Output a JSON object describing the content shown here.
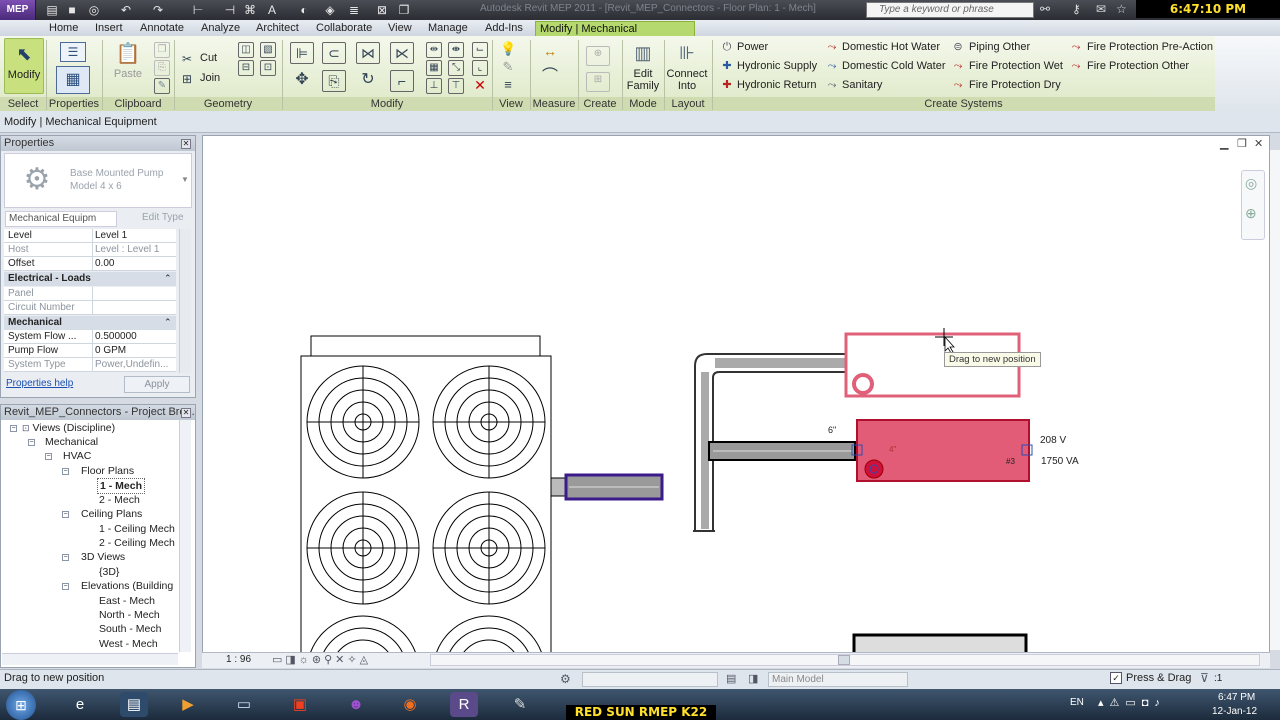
{
  "title_bar": {
    "app_label": "MEP",
    "title": "Autodesk Revit MEP 2011 - [Revit_MEP_Connectors - Floor Plan: 1 - Mech]",
    "search_placeholder": "Type a keyword or phrase",
    "clock_overlay": "6:47:10 PM 01/12/2012"
  },
  "tabs": [
    "Home",
    "Insert",
    "Annotate",
    "Analyze",
    "Architect",
    "Collaborate",
    "View",
    "Manage",
    "Add-Ins",
    "Modify | Mechanical Equipment"
  ],
  "ribbon": {
    "modify_label": "Modify",
    "paste_label": "Paste",
    "cut_label": "Cut",
    "join_label": "Join",
    "edit_family_label": "Edit Family",
    "connect_into_label": "Connect Into",
    "panels": [
      "Select",
      "Properties",
      "Clipboard",
      "Geometry",
      "Modify",
      "View",
      "Measure",
      "Create",
      "Mode",
      "Layout",
      "Create Systems"
    ],
    "systems": [
      [
        "Power",
        "Domestic Hot Water",
        "Piping Other",
        "Fire Protection Pre-Action"
      ],
      [
        "Hydronic Supply",
        "Domestic Cold Water",
        "Fire Protection Wet",
        "Fire Protection Other"
      ],
      [
        "Hydronic Return",
        "Sanitary",
        "Fire Protection Dry"
      ]
    ]
  },
  "options_bar": "Modify | Mechanical Equipment",
  "properties": {
    "title": "Properties",
    "type_name": "Base Mounted Pump",
    "type_model": "Model 4 x 6",
    "category": "Mechanical Equipm",
    "edit_type": "Edit Type",
    "rows": [
      {
        "k": "Level",
        "v": "Level 1"
      },
      {
        "k": "Host",
        "v": "Level : Level 1"
      },
      {
        "k": "Offset",
        "v": "0.00"
      }
    ],
    "group_electrical": "Electrical - Loads",
    "electrical_rows": [
      {
        "k": "Panel",
        "v": ""
      },
      {
        "k": "Circuit Number",
        "v": ""
      }
    ],
    "group_mechanical": "Mechanical",
    "mechanical_rows": [
      {
        "k": "System Flow ...",
        "v": "0.500000"
      },
      {
        "k": "Pump Flow",
        "v": "0 GPM"
      },
      {
        "k": "System Type",
        "v": "Power,Undefin..."
      }
    ],
    "help": "Properties help",
    "apply": "Apply"
  },
  "browser": {
    "title": "Revit_MEP_Connectors - Project Bro...",
    "nodes": [
      "Views (Discipline)",
      "Mechanical",
      "HVAC",
      "Floor Plans",
      "1 - Mech",
      "2 - Mech",
      "Ceiling Plans",
      "1 - Ceiling Mech",
      "2 - Ceiling Mech",
      "3D Views",
      "{3D}",
      "Elevations (Building",
      "East - Mech",
      "North - Mech",
      "South - Mech",
      "West - Mech"
    ]
  },
  "canvas": {
    "tooltip": "Drag to new position",
    "pipe_size": "6\"",
    "pipe_size_small": "4\"",
    "conn_label": "#3",
    "voltage": "208 V",
    "load": "1750 VA",
    "scale": "1 : 96"
  },
  "status": {
    "message": "Drag to new position",
    "model": "Main Model",
    "press_drag": "Press & Drag",
    "filter": ":1"
  },
  "taskbar": {
    "banner": "RED SUN RMEP K22",
    "lang": "EN",
    "time": "6:47 PM",
    "date": "12-Jan-12"
  },
  "colors": {
    "accent": "#b6d96f",
    "equipment_red": "#e0607a",
    "pump_purple": "#3b1a8a"
  }
}
